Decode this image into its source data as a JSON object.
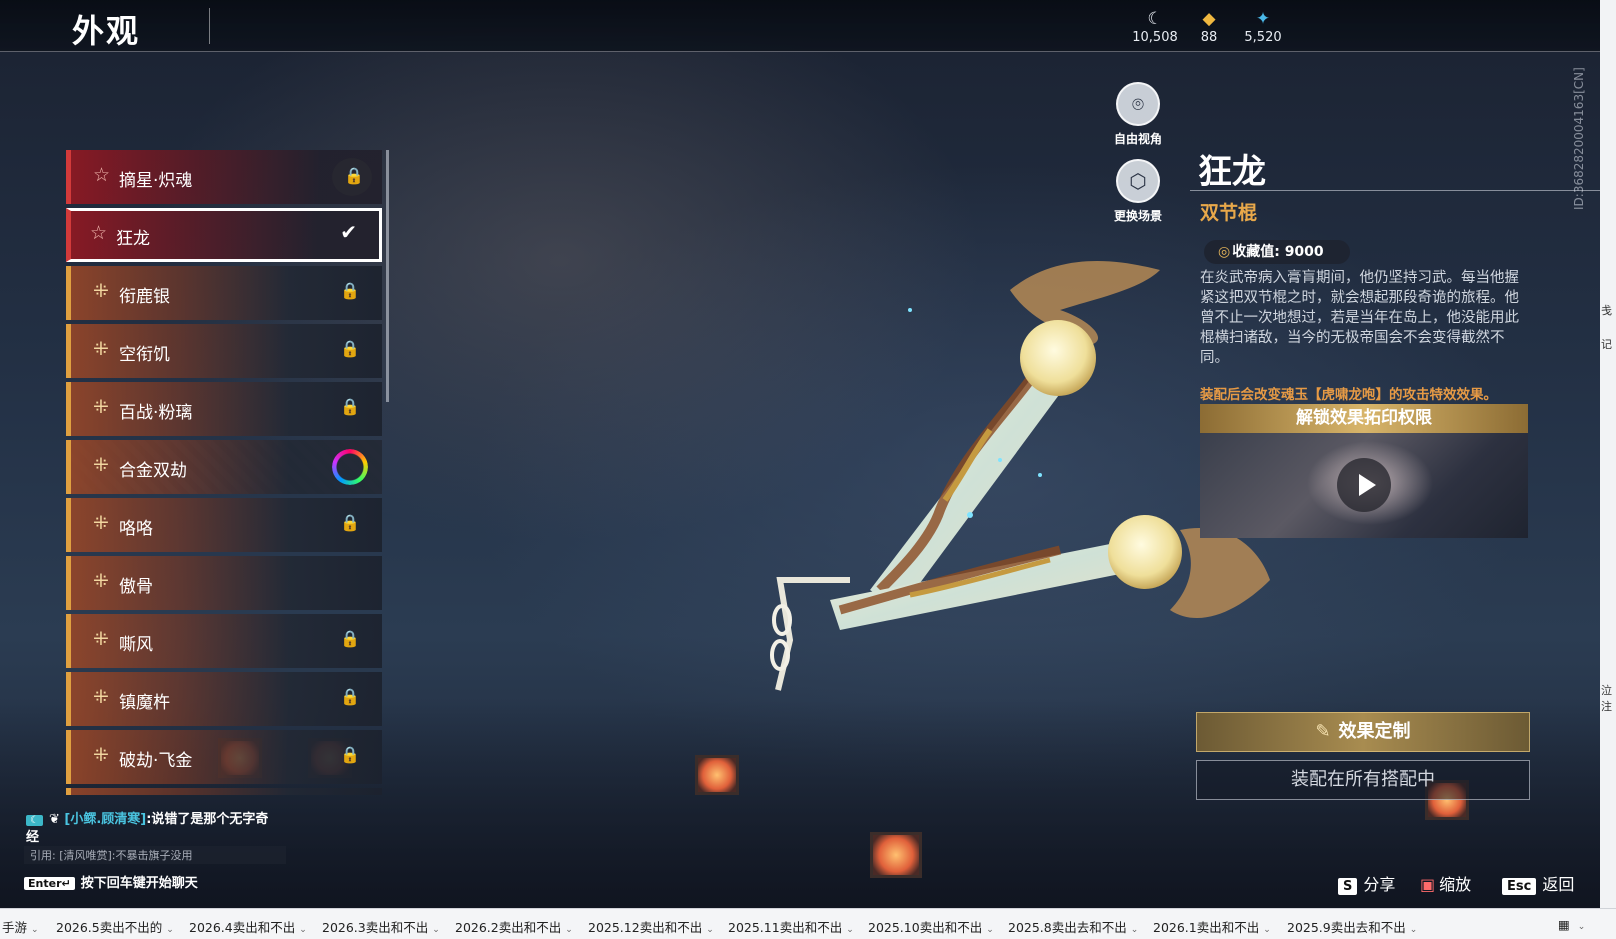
{
  "header": {
    "title": "外观",
    "currencies": [
      {
        "icon": "moon-coin-icon",
        "value": "10,508"
      },
      {
        "icon": "gold-ticket-icon",
        "value": "88"
      },
      {
        "icon": "feather-icon",
        "value": "5,520"
      }
    ]
  },
  "side_id": "ID:3682820004163[CN]",
  "right_strip": [
    "戋",
    "记",
    "泣注"
  ],
  "list": {
    "items": [
      {
        "label": "摘星·炽魂",
        "icon": "star-icon",
        "status": "locked"
      },
      {
        "label": "狂龙",
        "icon": "star-icon",
        "status": "selected"
      },
      {
        "label": "衔鹿银",
        "icon": "cross-icon",
        "status": "locked"
      },
      {
        "label": "空衔饥",
        "icon": "cross-icon",
        "status": "locked"
      },
      {
        "label": "百战·粉璃",
        "icon": "cross-icon",
        "status": "locked"
      },
      {
        "label": "合金双劫",
        "icon": "cross-icon",
        "status": "special"
      },
      {
        "label": "咯咯",
        "icon": "cross-icon",
        "status": "locked"
      },
      {
        "label": "傲骨",
        "icon": "cross-icon",
        "status": "owned"
      },
      {
        "label": "嘶风",
        "icon": "cross-icon",
        "status": "locked"
      },
      {
        "label": "镇魔杵",
        "icon": "cross-icon",
        "status": "locked"
      },
      {
        "label": "破劫·飞金",
        "icon": "cross-icon",
        "status": "locked"
      }
    ]
  },
  "camera": {
    "free_view": "自由视角",
    "change_scene": "更换场景"
  },
  "detail": {
    "name": "狂龙",
    "type": "双节棍",
    "collect_label": "收藏值: 9000",
    "description": "在炎武帝病入膏肓期间，他仍坚持习武。每当他握紧这把双节棍之时，就会想起那段奇诡的旅程。他曾不止一次地想过，若是当年在岛上，他没能用此棍横扫诸敌，当今的无极帝国会不会变得截然不同。",
    "effect_note": "装配后会改变魂玉【虎啸龙咆】的攻击特效效果。",
    "unlock_label": "解锁效果拓印权限",
    "custom_button": "效果定制",
    "equip_button": "装配在所有搭配中"
  },
  "chat": {
    "channel_tag": "",
    "nickname": "[小鳏.顾清寒]",
    "message": ":说错了是那个无字奇",
    "message_cont": "经",
    "quote": "引用: [清风唯赏]:不暴击旗子没用",
    "enter_key": "Enter↵",
    "enter_hint": "按下回车键开始聊天"
  },
  "hints": {
    "share_key": "S",
    "share": "分享",
    "zoom": "缩放",
    "back_key": "Esc",
    "back": "返回"
  },
  "tabs": [
    "手游",
    "2026.5卖出不出的",
    "2026.4卖出和不出",
    "2026.3卖出和不出",
    "2026.2卖出和不出",
    "2025.12卖出和不出",
    "2025.11卖出和不出",
    "2025.10卖出和不出",
    "2025.8卖出去和不出",
    "2026.1卖出和不出",
    "2025.9卖出去和不出"
  ],
  "tab_end_icon": "grid-icon",
  "colors": {
    "accent_gold": "#e8a84a",
    "selected_red": "#d23a3a",
    "effect_orange": "#e69a45"
  }
}
